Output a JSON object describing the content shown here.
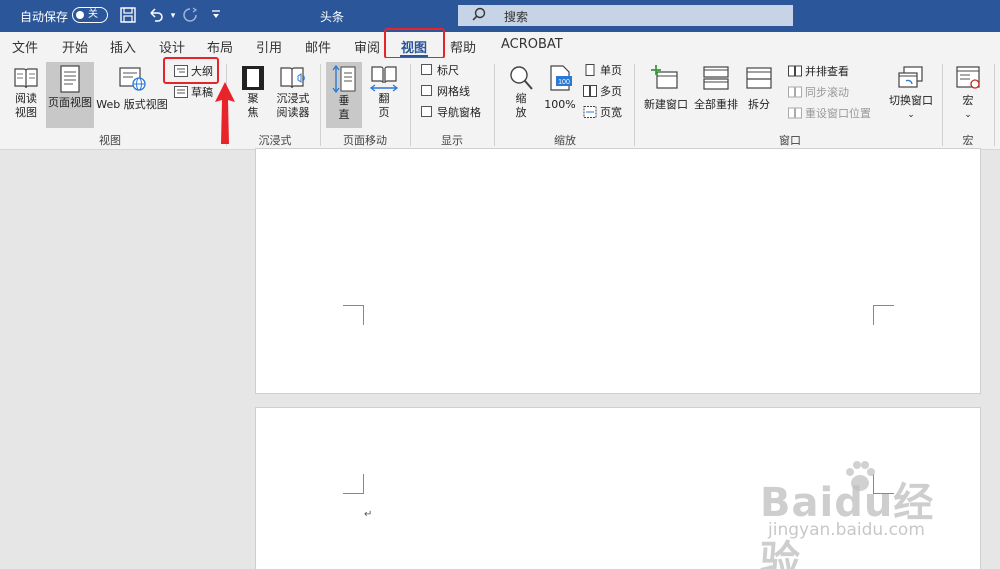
{
  "titlebar": {
    "autosave_label": "自动保存",
    "autosave_state": "关",
    "doc_title": "头条",
    "search_placeholder": "搜索"
  },
  "tabs": [
    {
      "label": "文件"
    },
    {
      "label": "开始"
    },
    {
      "label": "插入"
    },
    {
      "label": "设计"
    },
    {
      "label": "布局"
    },
    {
      "label": "引用"
    },
    {
      "label": "邮件"
    },
    {
      "label": "审阅"
    },
    {
      "label": "视图",
      "active": true
    },
    {
      "label": "帮助"
    },
    {
      "label": "ACROBAT"
    }
  ],
  "ribbon": {
    "views": {
      "group_label": "视图",
      "read_mode": [
        "阅读",
        "视图"
      ],
      "print_layout": "页面视图",
      "web_layout": "Web 版式视图",
      "outline": "大纲",
      "draft": "草稿"
    },
    "immersive": {
      "group_label": "沉浸式",
      "focus": [
        "聚",
        "焦"
      ],
      "reader": [
        "沉浸式",
        "阅读器"
      ]
    },
    "page_movement": {
      "group_label": "页面移动",
      "vertical": [
        "垂",
        "直"
      ],
      "side_to_side": [
        "翻",
        "页"
      ]
    },
    "show": {
      "group_label": "显示",
      "ruler": "标尺",
      "gridlines": "网格线",
      "nav_pane": "导航窗格"
    },
    "zoom": {
      "group_label": "缩放",
      "zoom": [
        "缩",
        "放"
      ],
      "hundred_icon": "100",
      "hundred_label": "100%",
      "one_page": "单页",
      "multiple_pages": "多页",
      "page_width": "页宽"
    },
    "window": {
      "group_label": "窗口",
      "new_window": "新建窗口",
      "arrange_all": "全部重排",
      "split": "拆分",
      "view_side_by_side": "并排查看",
      "sync_scrolling": "同步滚动",
      "reset_window": "重设窗口位置",
      "switch_windows": "切换窗口"
    },
    "macros": {
      "group_label": "宏",
      "macros": "宏"
    }
  },
  "document": {
    "paragraph_mark": "↵"
  },
  "watermark": {
    "brand": "Baidu经验",
    "url": "jingyan.baidu.com"
  },
  "colors": {
    "title_bar": "#2b579a",
    "highlight_red": "#e8232a",
    "ribbon_bg": "#f3f3f3"
  }
}
